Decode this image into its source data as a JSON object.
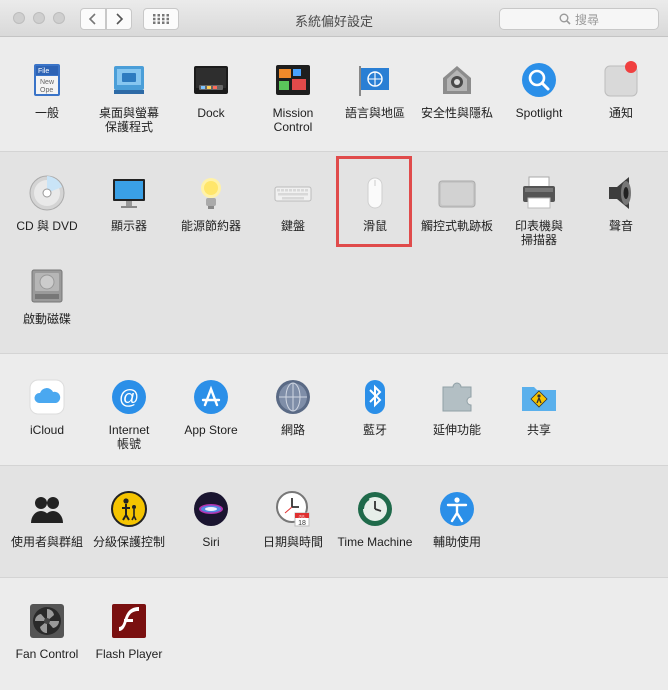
{
  "window": {
    "title": "系統偏好設定",
    "search_placeholder": "搜尋"
  },
  "colors": {
    "highlight": "#e04b4b"
  },
  "rows": [
    [
      {
        "id": "general",
        "label": "一般",
        "icon": "general-icon"
      },
      {
        "id": "desktop",
        "label": "桌面與螢幕\n保護程式",
        "icon": "desktop-icon"
      },
      {
        "id": "dock",
        "label": "Dock",
        "icon": "dock-icon"
      },
      {
        "id": "mission",
        "label": "Mission\nControl",
        "icon": "mission-control-icon"
      },
      {
        "id": "language",
        "label": "語言與地區",
        "icon": "language-icon"
      },
      {
        "id": "security",
        "label": "安全性與隱私",
        "icon": "security-icon"
      },
      {
        "id": "spotlight",
        "label": "Spotlight",
        "icon": "spotlight-icon"
      },
      {
        "id": "notifications",
        "label": "通知",
        "icon": "notifications-icon"
      }
    ],
    [
      {
        "id": "cddvd",
        "label": "CD 與 DVD",
        "icon": "cd-icon"
      },
      {
        "id": "displays",
        "label": "顯示器",
        "icon": "display-icon"
      },
      {
        "id": "energy",
        "label": "能源節約器",
        "icon": "bulb-icon"
      },
      {
        "id": "keyboard",
        "label": "鍵盤",
        "icon": "keyboard-icon"
      },
      {
        "id": "mouse",
        "label": "滑鼠",
        "icon": "mouse-icon"
      },
      {
        "id": "trackpad",
        "label": "觸控式軌跡板",
        "icon": "trackpad-icon"
      },
      {
        "id": "printers",
        "label": "印表機與\n掃描器",
        "icon": "printer-icon"
      },
      {
        "id": "sound",
        "label": "聲音",
        "icon": "speaker-icon"
      }
    ],
    [
      {
        "id": "startup",
        "label": "啟動磁碟",
        "icon": "disk-icon"
      }
    ],
    [
      {
        "id": "icloud",
        "label": "iCloud",
        "icon": "icloud-icon"
      },
      {
        "id": "internet",
        "label": "Internet\n帳號",
        "icon": "internet-accounts-icon"
      },
      {
        "id": "appstore",
        "label": "App Store",
        "icon": "appstore-icon"
      },
      {
        "id": "network",
        "label": "網路",
        "icon": "network-icon"
      },
      {
        "id": "bluetooth",
        "label": "藍牙",
        "icon": "bluetooth-icon"
      },
      {
        "id": "extensions",
        "label": "延伸功能",
        "icon": "puzzle-icon"
      },
      {
        "id": "sharing",
        "label": "共享",
        "icon": "sharing-icon"
      }
    ],
    [
      {
        "id": "users",
        "label": "使用者與群組",
        "icon": "users-icon"
      },
      {
        "id": "parental",
        "label": "分級保護控制",
        "icon": "parental-icon"
      },
      {
        "id": "siri",
        "label": "Siri",
        "icon": "siri-icon"
      },
      {
        "id": "datetime",
        "label": "日期與時間",
        "icon": "clock-icon"
      },
      {
        "id": "timemachine",
        "label": "Time Machine",
        "icon": "time-machine-icon"
      },
      {
        "id": "accessibility",
        "label": "輔助使用",
        "icon": "accessibility-icon"
      }
    ],
    [
      {
        "id": "fancontrol",
        "label": "Fan Control",
        "icon": "fan-icon"
      },
      {
        "id": "flash",
        "label": "Flash Player",
        "icon": "flash-icon"
      }
    ]
  ],
  "icon_text": {
    "file_top": "File",
    "file_mid": "New",
    "file_bot": "Ope",
    "calendar_month": "JUL",
    "calendar_day": "18"
  }
}
